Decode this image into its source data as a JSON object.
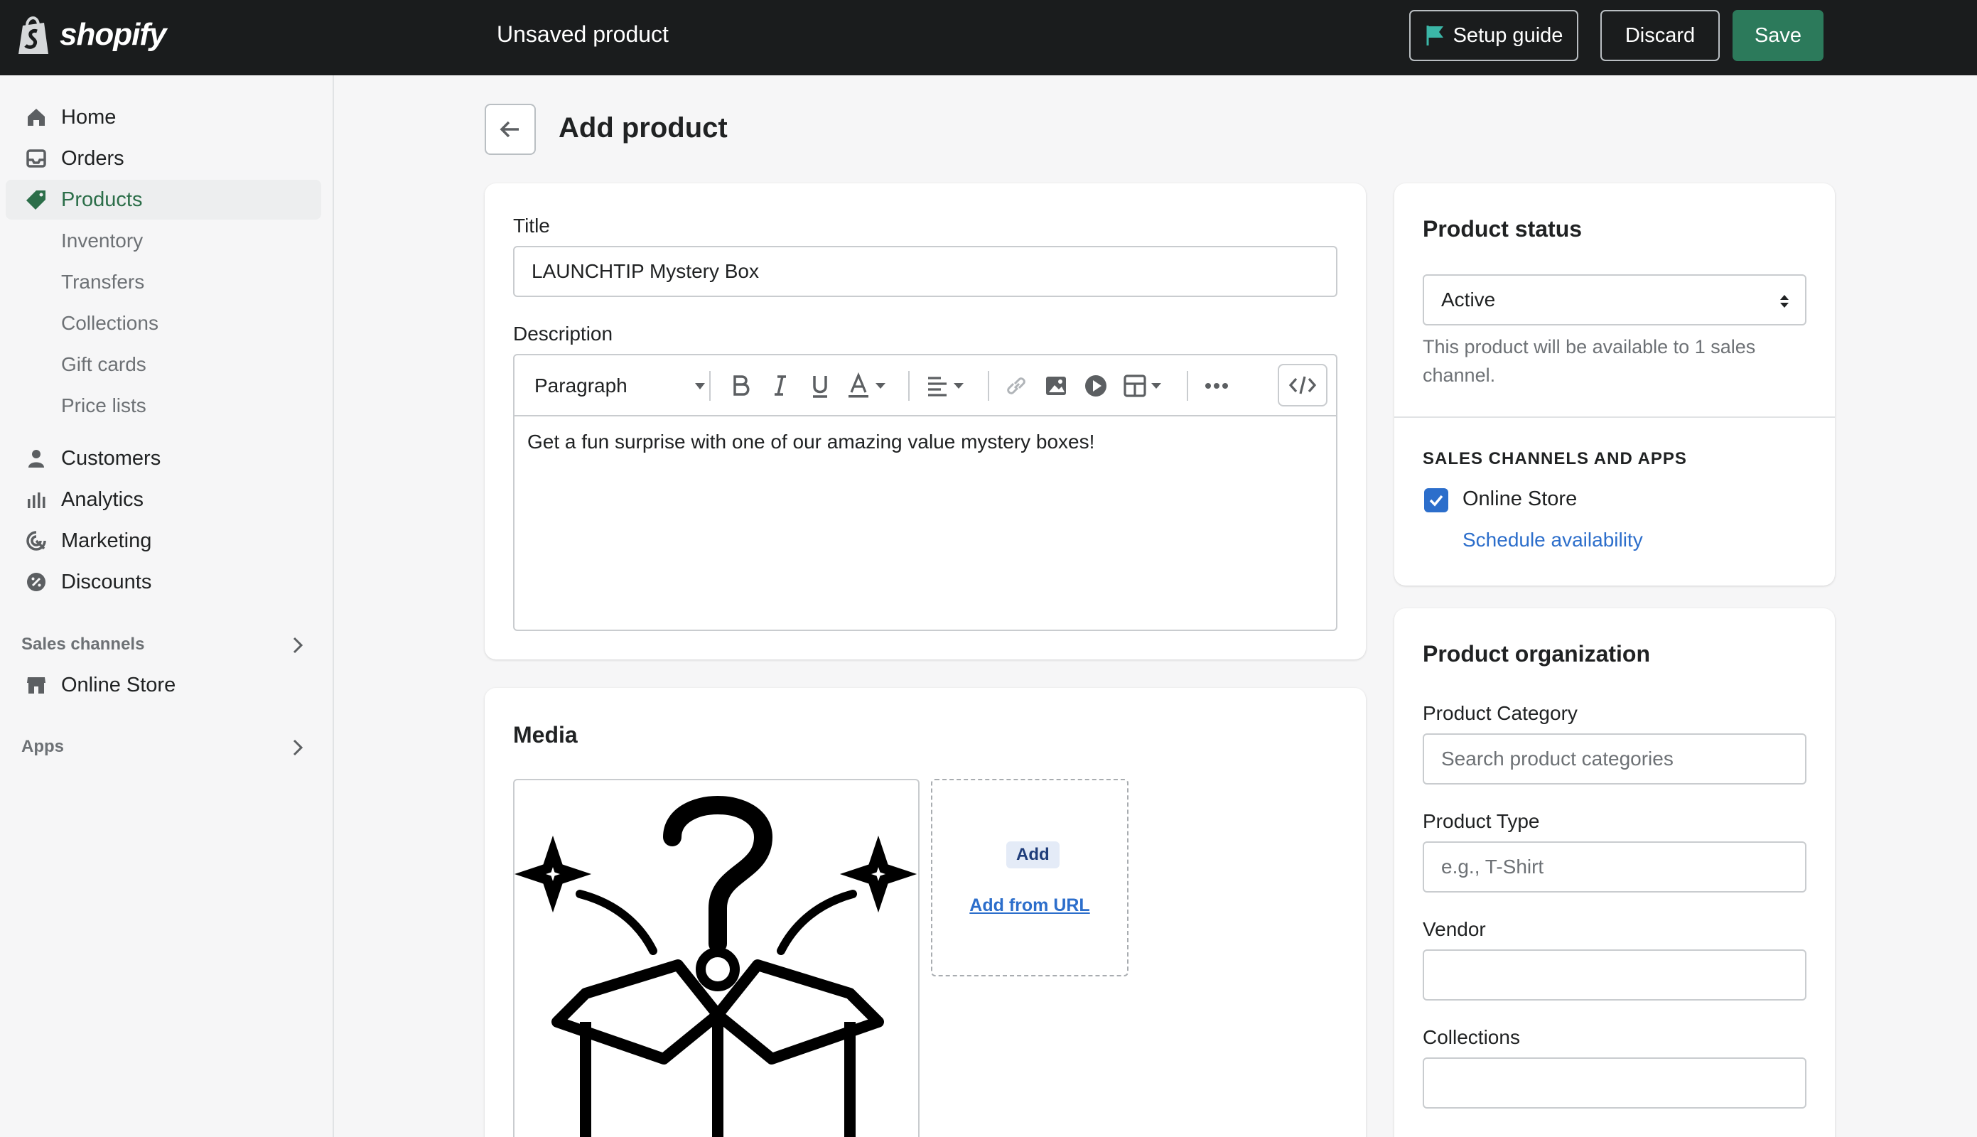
{
  "topbar": {
    "brand": "shopify",
    "title": "Unsaved product",
    "setup_label": "Setup guide",
    "discard_label": "Discard",
    "save_label": "Save"
  },
  "sidebar": {
    "items": [
      {
        "label": "Home",
        "icon": "home-icon"
      },
      {
        "label": "Orders",
        "icon": "inbox-icon"
      },
      {
        "label": "Products",
        "icon": "tag-icon"
      },
      {
        "label": "Customers",
        "icon": "person-icon"
      },
      {
        "label": "Analytics",
        "icon": "bar-chart-icon"
      },
      {
        "label": "Marketing",
        "icon": "target-icon"
      },
      {
        "label": "Discounts",
        "icon": "discount-icon"
      },
      {
        "label": "Online Store",
        "icon": "store-icon"
      }
    ],
    "sub_items": [
      "Inventory",
      "Transfers",
      "Collections",
      "Gift cards",
      "Price lists"
    ],
    "sections": [
      "Sales channels",
      "Apps"
    ]
  },
  "page": {
    "title": "Add product"
  },
  "product_form": {
    "title_label": "Title",
    "title_value": "LAUNCHTIP Mystery Box",
    "description_label": "Description",
    "toolbar_format": "Paragraph",
    "description_text": "Get a fun surprise with one of our amazing value mystery boxes!"
  },
  "media": {
    "heading": "Media",
    "add_label": "Add",
    "add_url_label": "Add from URL"
  },
  "status": {
    "heading": "Product status",
    "selected": "Active",
    "help": "This product will be available to 1 sales channel.",
    "channels_heading": "SALES CHANNELS AND APPS",
    "channel_name": "Online Store",
    "channel_checked": true,
    "schedule_link": "Schedule availability"
  },
  "organization": {
    "heading": "Product organization",
    "category_label": "Product Category",
    "category_placeholder": "Search product categories",
    "type_label": "Product Type",
    "type_placeholder": "e.g., T-Shirt",
    "vendor_label": "Vendor",
    "collections_label": "Collections"
  },
  "colors": {
    "topbar_bg": "#1a1c1d",
    "save_green": "#2c7a5b",
    "active_nav_green": "#2c6e49",
    "link_blue": "#2c6ecb"
  }
}
